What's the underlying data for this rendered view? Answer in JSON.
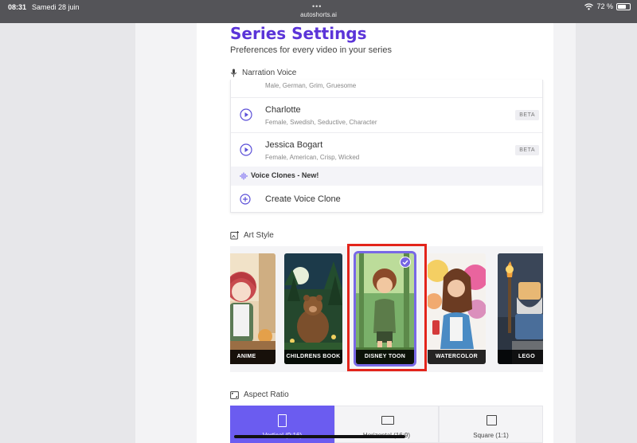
{
  "statusbar": {
    "time": "08:31",
    "date": "Samedi 28 juin",
    "url": "autoshorts.ai",
    "battery": "72 %",
    "battery_level": 0.72
  },
  "header": {
    "title": "Series Settings",
    "subtitle": "Preferences for every video in your series"
  },
  "narration": {
    "label": "Narration Voice",
    "cut_desc": "Male, German, Grim, Gruesome",
    "voices": [
      {
        "name": "Charlotte",
        "desc": "Female, Swedish, Seductive, Character",
        "badge": "BETA"
      },
      {
        "name": "Jessica Bogart",
        "desc": "Female, American, Crisp, Wicked",
        "badge": "BETA"
      }
    ],
    "clones_header": "Voice Clones - New!",
    "create_clone": "Create Voice Clone"
  },
  "art_style": {
    "label": "Art Style",
    "styles": [
      {
        "name": "ANIME"
      },
      {
        "name": "CHILDRENS BOOK"
      },
      {
        "name": "DISNEY TOON",
        "selected": true
      },
      {
        "name": "WATERCOLOR"
      },
      {
        "name": "LEGO"
      }
    ]
  },
  "aspect_ratio": {
    "label": "Aspect Ratio",
    "options": [
      {
        "name": "Vertical (9:16)",
        "active": true
      },
      {
        "name": "Horizontal (16:9)"
      },
      {
        "name": "Square (1:1)"
      }
    ]
  },
  "colors": {
    "accent": "#5b34d8",
    "selected": "#6b5cf0",
    "highlight": "#e3241b"
  }
}
